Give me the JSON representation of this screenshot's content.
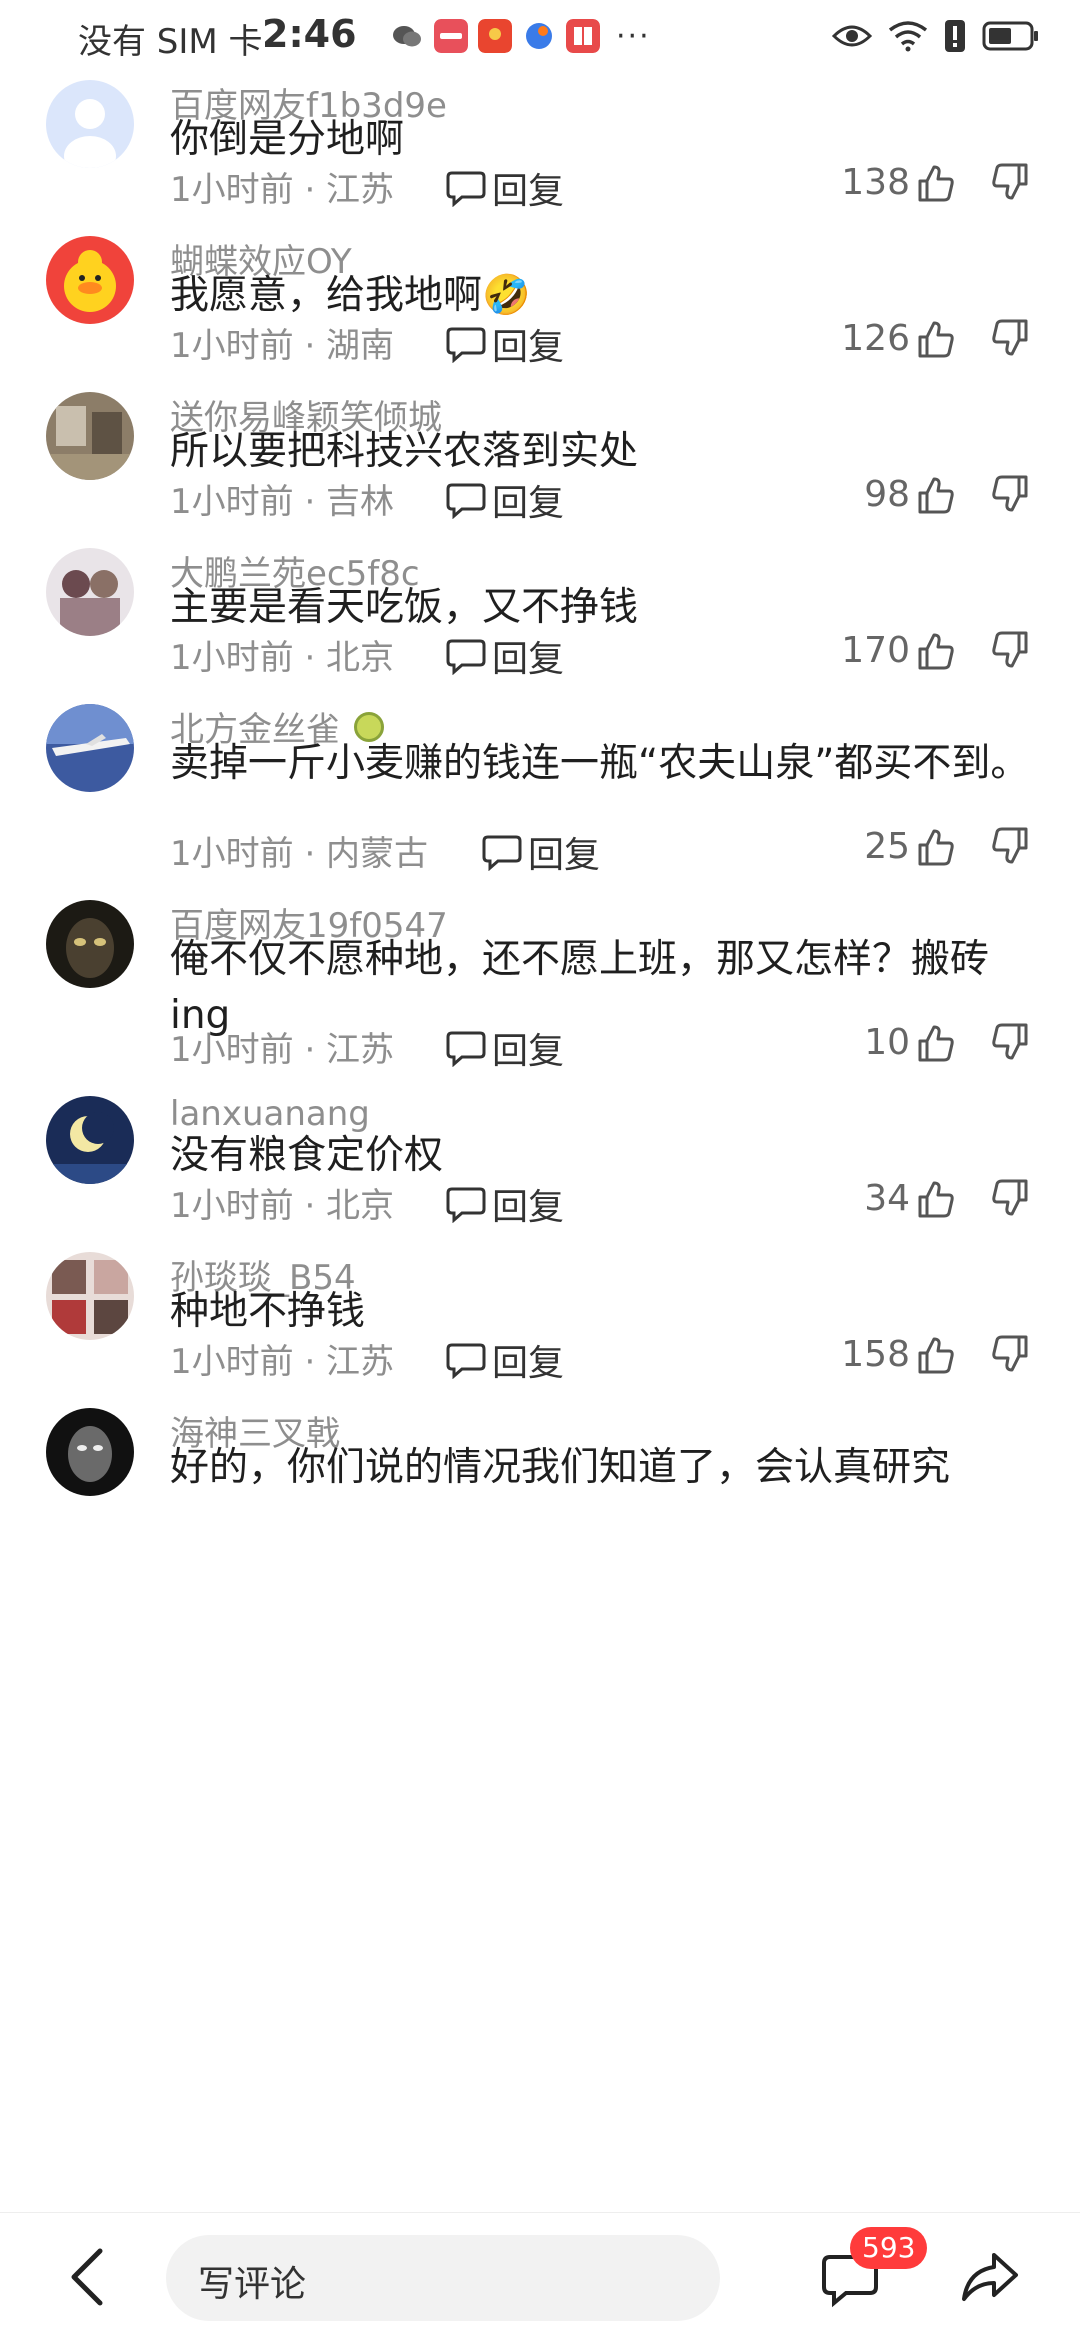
{
  "status_bar": {
    "carrier": "没有 SIM 卡",
    "time": "2:46",
    "more": "···"
  },
  "comments": [
    {
      "user": "百度网友f1b3d9e",
      "text": "你倒是分地啊",
      "time": "1小时前 · 江苏",
      "reply": "回复",
      "likes": "138"
    },
    {
      "user": "蝴蝶效应OY",
      "text": "我愿意，给我地啊🤣",
      "time": "1小时前 · 湖南",
      "reply": "回复",
      "likes": "126"
    },
    {
      "user": "送你易峰颖笑倾城",
      "text": "所以要把科技兴农落到实处",
      "time": "1小时前 · 吉林",
      "reply": "回复",
      "likes": "98"
    },
    {
      "user": "大鹏兰苑ec5f8c",
      "text": "主要是看天吃饭，又不挣钱",
      "time": "1小时前 · 北京",
      "reply": "回复",
      "likes": "170"
    },
    {
      "user": "北方金丝雀",
      "text": "卖掉一斤小麦赚的钱连一瓶“农夫山泉”都买不到。",
      "time": "1小时前 · 内蒙古",
      "reply": "回复",
      "likes": "25"
    },
    {
      "user": "百度网友19f0547",
      "text": "俺不仅不愿种地，还不愿上班，那又怎样？搬砖ing",
      "time": "1小时前 · 江苏",
      "reply": "回复",
      "likes": "10"
    },
    {
      "user": "lanxuanang",
      "text": "没有粮食定价权",
      "time": "1小时前 · 北京",
      "reply": "回复",
      "likes": "34"
    },
    {
      "user": "孙琰琰_B54",
      "text": "种地不挣钱",
      "time": "1小时前 · 江苏",
      "reply": "回复",
      "likes": "158"
    },
    {
      "user": "海神三叉戟",
      "text": "好的，你们说的情况我们知道了，会认真研究"
    }
  ],
  "bottom_bar": {
    "input_placeholder": "写评论",
    "comment_count": "593"
  },
  "colors": {
    "accent_badge": "#ff3b3b",
    "secondary_text": "#8e8e8e"
  }
}
